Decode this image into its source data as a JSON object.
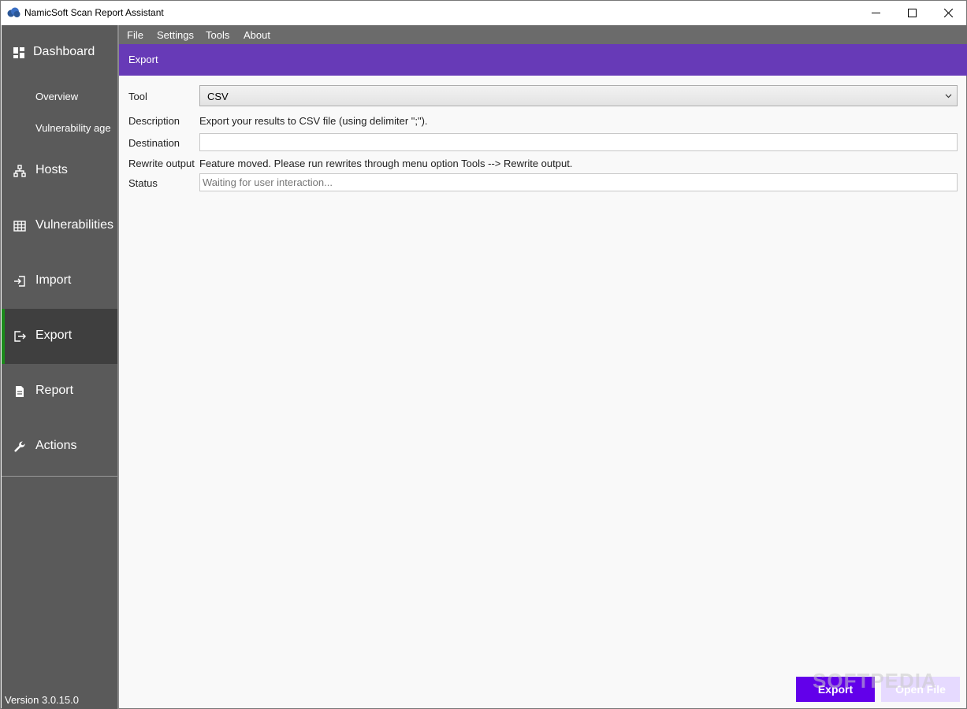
{
  "window": {
    "title": "NamicSoft Scan Report Assistant",
    "icon": "cloud-icon"
  },
  "menu": {
    "items": [
      "File",
      "Settings",
      "Tools",
      "About"
    ]
  },
  "sidebar": {
    "dashboard": "Dashboard",
    "sub_items": [
      "Overview",
      "Vulnerability age"
    ],
    "items": [
      {
        "label": "Hosts",
        "icon": "network-icon"
      },
      {
        "label": "Vulnerabilities",
        "icon": "table-icon"
      },
      {
        "label": "Import",
        "icon": "import-icon"
      },
      {
        "label": "Export",
        "icon": "export-icon",
        "active": true
      },
      {
        "label": "Report",
        "icon": "document-icon"
      },
      {
        "label": "Actions",
        "icon": "wrench-icon"
      }
    ],
    "version": "Version 3.0.15.0",
    "active_color": "#1a8a1a"
  },
  "header": {
    "title": "Export",
    "color": "#673ab7"
  },
  "form": {
    "tool_label": "Tool",
    "tool_value": "CSV",
    "description_label": "Description",
    "description_value": "Export your results to CSV file (using delimiter \";\").",
    "destination_label": "Destination",
    "destination_value": "",
    "rewrite_label": "Rewrite output",
    "rewrite_value": "Feature moved. Please run rewrites through menu option Tools --> Rewrite output.",
    "status_label": "Status",
    "status_placeholder": "Waiting for user interaction..."
  },
  "buttons": {
    "export": "Export",
    "open_file": "Open File",
    "accent": "#6200ea"
  },
  "watermark": "SOFTPEDIA"
}
